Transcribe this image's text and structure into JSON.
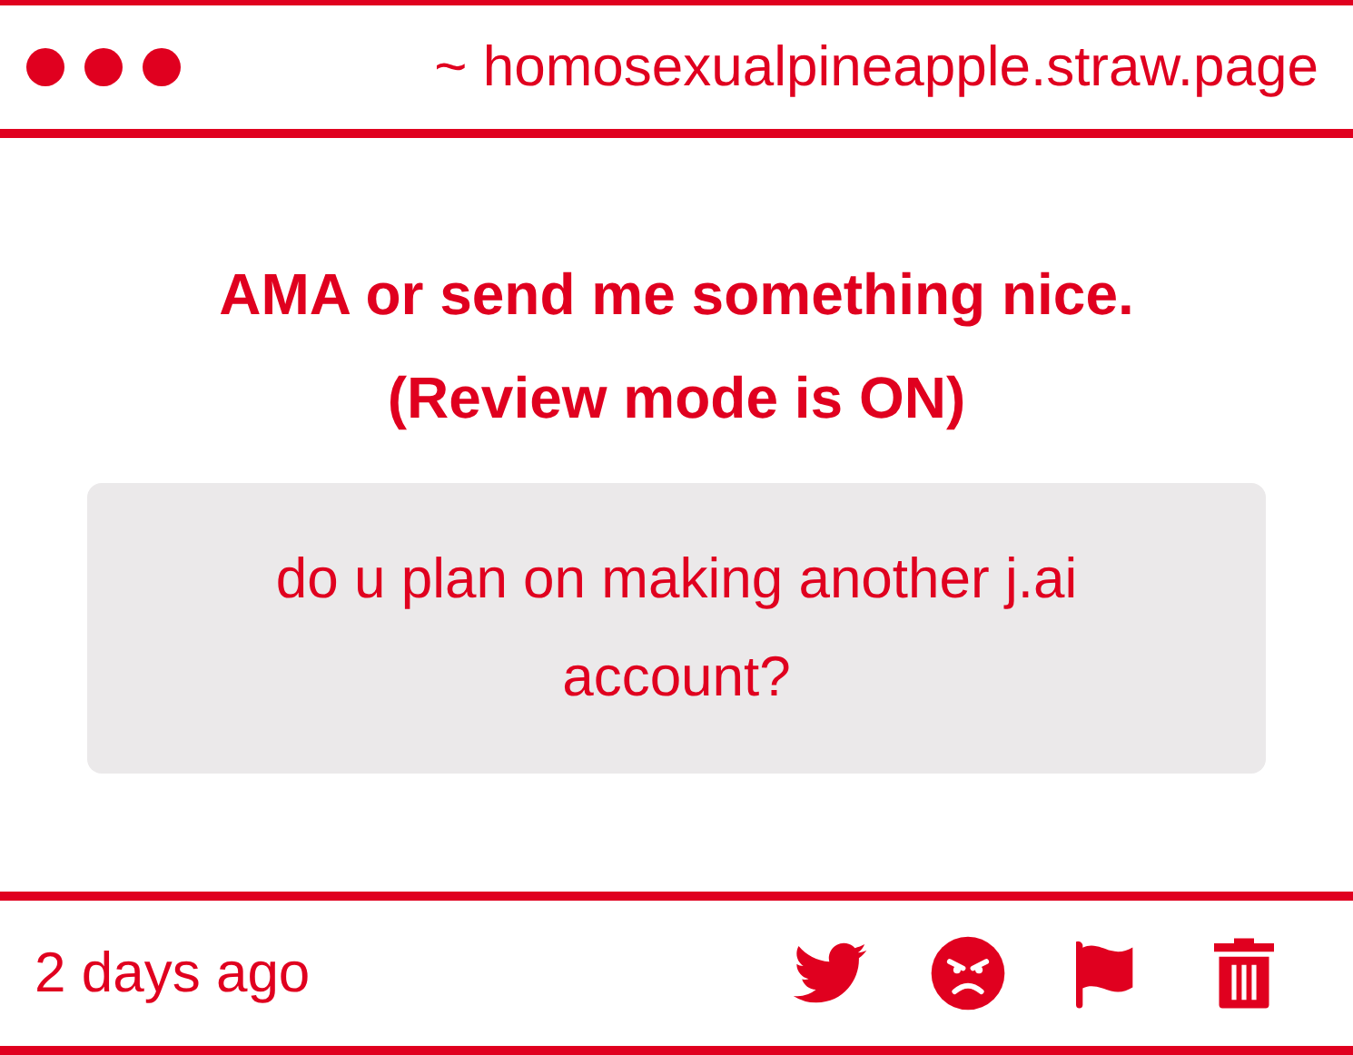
{
  "header": {
    "url": "~ homosexualpineapple.straw.page"
  },
  "title_lines": [
    "AMA or send me something nice.",
    "(Review mode is ON)"
  ],
  "question": "do u plan on making another j.ai account?",
  "footer": {
    "time": "2 days ago",
    "actions": [
      {
        "kind": "bird"
      },
      {
        "kind": "angry"
      },
      {
        "kind": "flag"
      },
      {
        "kind": "trash"
      }
    ]
  }
}
